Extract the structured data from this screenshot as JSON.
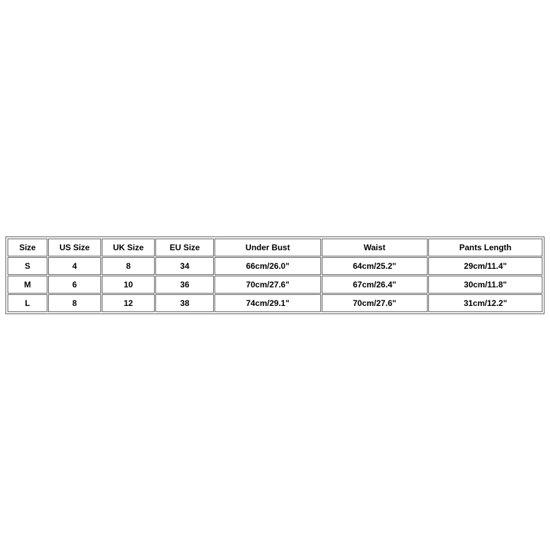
{
  "chart_data": {
    "type": "table",
    "headers": [
      "Size",
      "US Size",
      "UK Size",
      "EU Size",
      "Under Bust",
      "Waist",
      "Pants Length"
    ],
    "rows": [
      {
        "size": "S",
        "us": "4",
        "uk": "8",
        "eu": "34",
        "under_bust": "66cm/26.0\"",
        "waist": "64cm/25.2\"",
        "pants_length": "29cm/11.4\""
      },
      {
        "size": "M",
        "us": "6",
        "uk": "10",
        "eu": "36",
        "under_bust": "70cm/27.6\"",
        "waist": "67cm/26.4\"",
        "pants_length": "30cm/11.8\""
      },
      {
        "size": "L",
        "us": "8",
        "uk": "12",
        "eu": "38",
        "under_bust": "74cm/29.1\"",
        "waist": "70cm/27.6\"",
        "pants_length": "31cm/12.2\""
      }
    ]
  }
}
